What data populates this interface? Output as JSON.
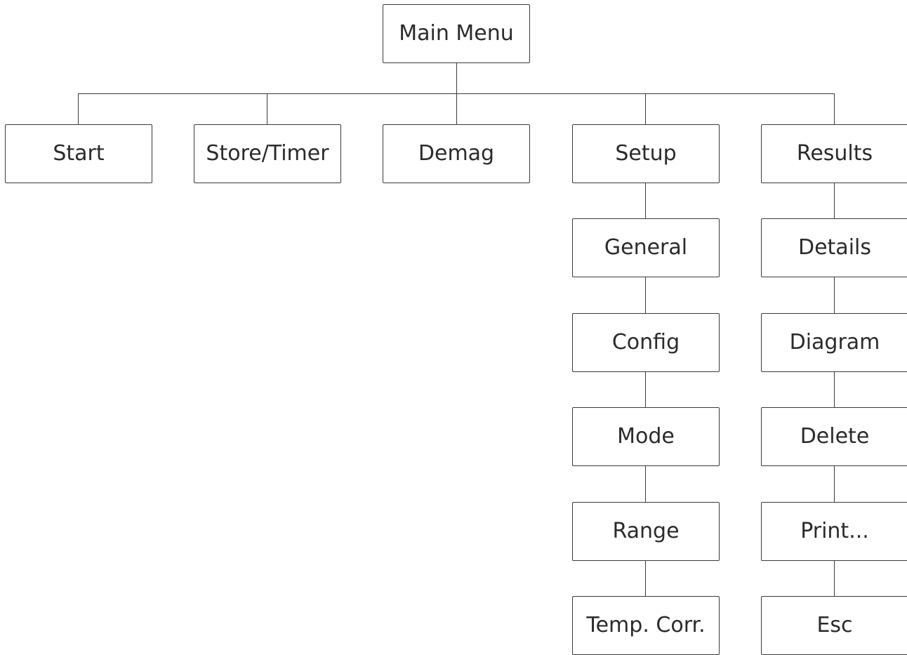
{
  "root": {
    "label": "Main Menu"
  },
  "top_level": [
    {
      "label": "Start"
    },
    {
      "label": "Store/Timer"
    },
    {
      "label": "Demag"
    },
    {
      "label": "Setup"
    },
    {
      "label": "Results"
    }
  ],
  "setup_children": [
    {
      "label": "General"
    },
    {
      "label": "Config"
    },
    {
      "label": "Mode"
    },
    {
      "label": "Range"
    },
    {
      "label": "Temp. Corr."
    }
  ],
  "results_children": [
    {
      "label": "Details"
    },
    {
      "label": "Diagram"
    },
    {
      "label": "Delete"
    },
    {
      "label": "Print..."
    },
    {
      "label": "Esc"
    }
  ]
}
